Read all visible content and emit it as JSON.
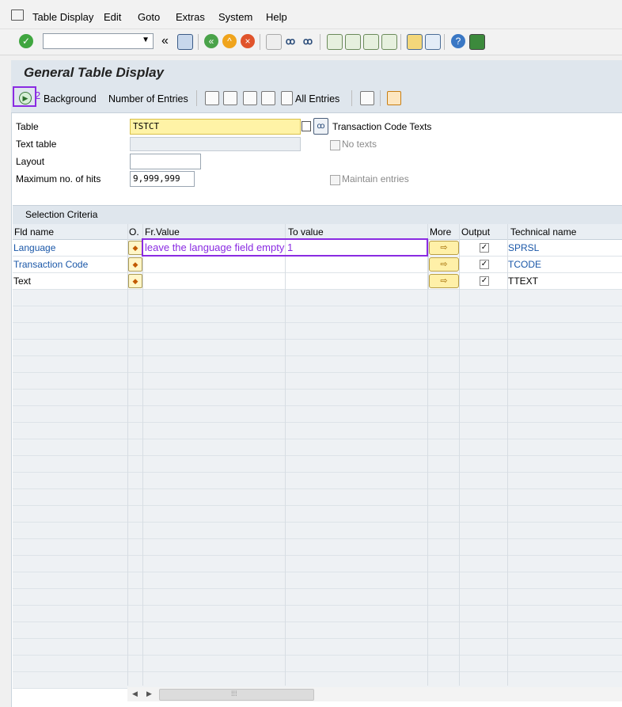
{
  "menu": {
    "items": [
      "Table Display",
      "Edit",
      "Goto",
      "Extras",
      "System",
      "Help"
    ]
  },
  "toolbar": {
    "command_field": "",
    "back_glyph": "«"
  },
  "page": {
    "title": "General Table Display"
  },
  "appbar": {
    "background_label": "Background",
    "number_entries_label": "Number of Entries",
    "all_entries_label": "All Entries"
  },
  "form": {
    "table_label": "Table",
    "table_value": "TSTCT",
    "table_desc": "Transaction Code Texts",
    "text_table_label": "Text table",
    "text_table_value": "",
    "no_texts_label": "No texts",
    "layout_label": "Layout",
    "layout_value": "",
    "max_hits_label": "Maximum no. of hits",
    "max_hits_value": "9,999,999",
    "maintain_label": "Maintain entries"
  },
  "selection": {
    "title": "Selection Criteria",
    "columns": {
      "fld_name": "Fld name",
      "o": "O.",
      "fr_value": "Fr.Value",
      "to_value": "To value",
      "more": "More",
      "output": "Output",
      "tech_name": "Technical name"
    },
    "rows": [
      {
        "name": "Language",
        "fr": "",
        "to": "",
        "output": true,
        "tech": "SPRSL"
      },
      {
        "name": "Transaction Code",
        "fr": "",
        "to": "",
        "output": true,
        "tech": "TCODE"
      },
      {
        "name": "Text",
        "fr": "",
        "to": "",
        "output": true,
        "tech": "TTEXT"
      }
    ]
  },
  "annotations": {
    "step1_text": "leave the language field empty  1",
    "step2_number": "2"
  },
  "colors": {
    "accent": "#8a2be2",
    "link": "#1a57a8",
    "header_bg": "#dfe6ed"
  },
  "icons": {
    "check": "check-icon",
    "save": "save-icon",
    "execute": "execute-icon"
  },
  "scrollbar": {
    "left_arrow": "◀",
    "right_arrow": "▶",
    "grip": "⁞⁞⁞"
  }
}
